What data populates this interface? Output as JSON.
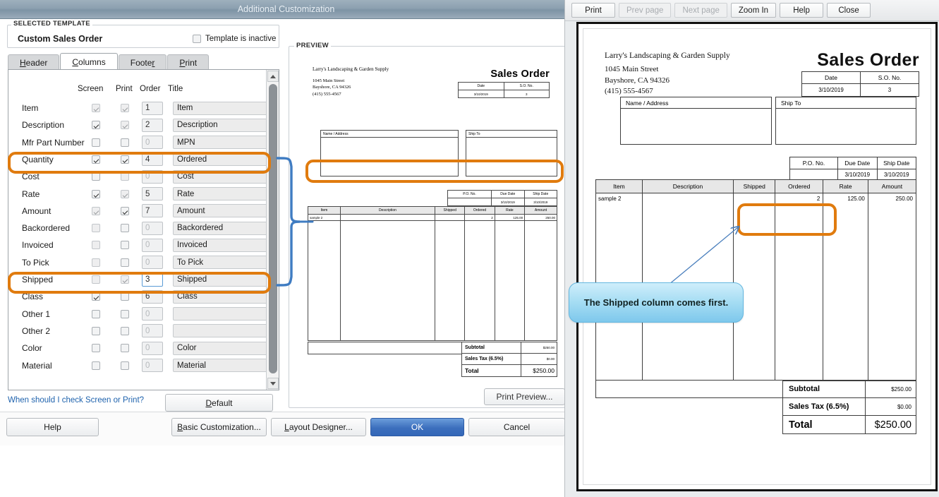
{
  "dialog": {
    "title": "Additional Customization",
    "selected_template": {
      "legend": "SELECTED TEMPLATE",
      "name": "Custom Sales Order",
      "inactive_label": "Template is inactive",
      "inactive_checked": false
    },
    "tabs": [
      {
        "label": "Header",
        "active": false
      },
      {
        "label": "Columns",
        "active": true
      },
      {
        "label": "Footer",
        "active": false
      },
      {
        "label": "Print",
        "active": false
      }
    ],
    "columns_headers": [
      "Screen",
      "Print",
      "Order",
      "Title"
    ],
    "rows": [
      {
        "name": "Item",
        "screen": true,
        "screen_dim": true,
        "print": true,
        "print_dim": true,
        "order": "1",
        "title": "Item"
      },
      {
        "name": "Description",
        "screen": true,
        "screen_dim": false,
        "print": true,
        "print_dim": true,
        "order": "2",
        "title": "Description"
      },
      {
        "name": "Mfr Part Number",
        "screen": false,
        "screen_dim": false,
        "print": false,
        "print_dim": false,
        "order": "0",
        "title": "MPN"
      },
      {
        "name": "Quantity",
        "screen": true,
        "screen_dim": false,
        "print": true,
        "print_dim": false,
        "order": "4",
        "title": "Ordered"
      },
      {
        "name": "Cost",
        "screen": false,
        "screen_dim": false,
        "print": false,
        "print_dim": true,
        "order": "0",
        "title": "Cost"
      },
      {
        "name": "Rate",
        "screen": true,
        "screen_dim": false,
        "print": true,
        "print_dim": true,
        "order": "5",
        "title": "Rate"
      },
      {
        "name": "Amount",
        "screen": true,
        "screen_dim": true,
        "print": true,
        "print_dim": false,
        "order": "7",
        "title": "Amount"
      },
      {
        "name": "Backordered",
        "screen": false,
        "screen_dim": true,
        "print": false,
        "print_dim": false,
        "order": "0",
        "title": "Backordered"
      },
      {
        "name": "Invoiced",
        "screen": false,
        "screen_dim": true,
        "print": false,
        "print_dim": false,
        "order": "0",
        "title": "Invoiced"
      },
      {
        "name": "To Pick",
        "screen": false,
        "screen_dim": true,
        "print": false,
        "print_dim": false,
        "order": "0",
        "title": "To Pick"
      },
      {
        "name": "Shipped",
        "screen": false,
        "screen_dim": true,
        "print": true,
        "print_dim": true,
        "order": "3",
        "title": "Shipped",
        "order_focused": true
      },
      {
        "name": "Class",
        "screen": true,
        "screen_dim": false,
        "print": false,
        "print_dim": false,
        "order": "6",
        "title": "Class"
      },
      {
        "name": "Other 1",
        "screen": false,
        "screen_dim": false,
        "print": false,
        "print_dim": false,
        "order": "0",
        "title": ""
      },
      {
        "name": "Other 2",
        "screen": false,
        "screen_dim": false,
        "print": false,
        "print_dim": false,
        "order": "0",
        "title": ""
      },
      {
        "name": "Color",
        "screen": false,
        "screen_dim": false,
        "print": false,
        "print_dim": false,
        "order": "0",
        "title": "Color"
      },
      {
        "name": "Material",
        "screen": false,
        "screen_dim": false,
        "print": false,
        "print_dim": false,
        "order": "0",
        "title": "Material"
      }
    ],
    "help_link": "When should I check Screen or Print?",
    "default_button": "Default",
    "preview_legend": "PREVIEW",
    "print_preview_button": "Print Preview...",
    "buttons": {
      "help": "Help",
      "basic_customization": "Basic Customization...",
      "layout_designer": "Layout Designer...",
      "ok": "OK",
      "cancel": "Cancel"
    },
    "highlight_color": "#e07b0e",
    "accent_color": "#3467b8"
  },
  "document": {
    "company": "Larry's Landscaping & Garden Supply",
    "address_line1": "1045 Main Street",
    "address_line2": "Bayshore, CA 94326",
    "phone": "(415) 555-4567",
    "title": "Sales Order",
    "date_table": {
      "headers": [
        "Date",
        "S.O. No."
      ],
      "values": [
        "3/10/2019",
        "3"
      ]
    },
    "name_address_caption": "Name / Address",
    "ship_to_caption": "Ship To",
    "po_table": {
      "headers": [
        "P.O. No.",
        "Due Date",
        "Ship Date"
      ],
      "values": [
        "",
        "3/10/2019",
        "3/10/2019"
      ]
    },
    "items_table": {
      "headers": [
        "Item",
        "Description",
        "Shipped",
        "Ordered",
        "Rate",
        "Amount"
      ],
      "rows": [
        {
          "item": "sample 2",
          "description": "",
          "shipped": "",
          "ordered": "2",
          "rate": "125.00",
          "amount": "250.00"
        }
      ]
    },
    "totals": [
      {
        "label": "Subtotal",
        "value": "$250.00"
      },
      {
        "label": "Sales Tax  (6.5%)",
        "value": "$0.00"
      },
      {
        "label": "Total",
        "value": "$250.00"
      }
    ]
  },
  "print_preview_window": {
    "toolbar": [
      {
        "label": "Print",
        "disabled": false
      },
      {
        "label": "Prev page",
        "disabled": true
      },
      {
        "label": "Next page",
        "disabled": true
      },
      {
        "label": "Zoom In",
        "disabled": false
      },
      {
        "label": "Help",
        "disabled": false
      },
      {
        "label": "Close",
        "disabled": false
      }
    ]
  },
  "callout": {
    "text": "The Shipped column comes first."
  }
}
